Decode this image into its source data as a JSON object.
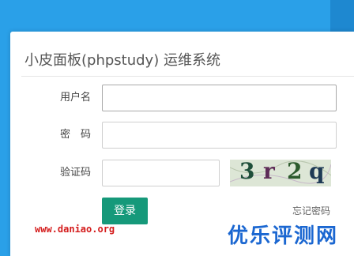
{
  "login": {
    "title": "小皮面板(phpstudy) 运维系统",
    "username_label": "用户名",
    "username_value": "",
    "password_label": "密　码",
    "password_value": "",
    "captcha_label": "验证码",
    "captcha_value": "",
    "captcha_text": [
      "3",
      "r",
      "2",
      "q"
    ],
    "login_button": "登录",
    "forgot_link": "忘记密码"
  },
  "watermark": {
    "url": "www.daniao.org",
    "site": "优乐评测网"
  }
}
